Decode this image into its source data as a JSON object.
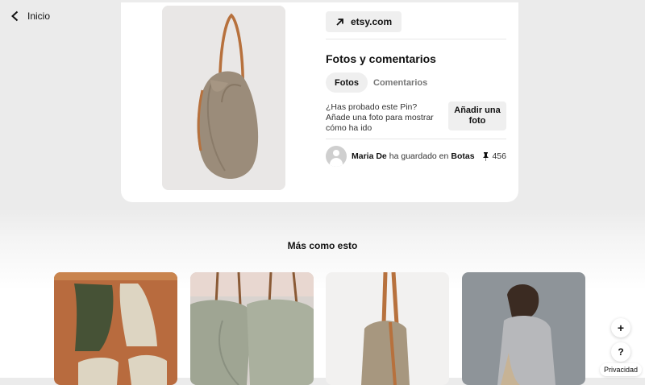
{
  "nav": {
    "back_label": "Inicio"
  },
  "pin": {
    "source_label": "etsy.com",
    "photos_title": "Fotos y comentarios",
    "tabs": [
      {
        "label": "Fotos"
      },
      {
        "label": "Comentarios"
      }
    ],
    "prompt_text": "¿Has probado este Pin? Añade una foto para mostrar cómo ha ido",
    "add_photo_label": "Añadir una foto",
    "saver": {
      "name": "Maria De",
      "verb": "ha guardado en",
      "board": "Botas"
    },
    "save_count": "456"
  },
  "more": {
    "title": "Más como esto"
  },
  "floating": {
    "add_label": "+",
    "help_label": "?",
    "privacy_label": "Privacidad"
  },
  "icons": {
    "back": "chevron-left-icon",
    "source": "arrow-up-right-icon",
    "visual_search": "visual-search-icon",
    "pin": "pushpin-icon"
  },
  "colors": {
    "page_bg": "#ebebeb",
    "button_bg": "#efefef",
    "text": "#111111"
  }
}
